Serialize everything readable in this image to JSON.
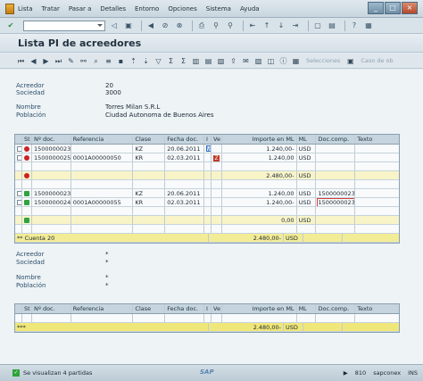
{
  "menu": {
    "items": [
      "Lista",
      "Tratar",
      "Pasar a",
      "Detalles",
      "Entorno",
      "Opciones",
      "Sistema",
      "Ayuda"
    ]
  },
  "page": {
    "title": "Lista PI de acreedores"
  },
  "toolbar2": {
    "selections_label": "Selecciones",
    "case_label": "Caso de ob"
  },
  "header1": {
    "acreedor_label": "Acreedor",
    "acreedor_value": "20",
    "sociedad_label": "Sociedad",
    "sociedad_value": "3000",
    "nombre_label": "Nombre",
    "nombre_value": "Torres Milan S.R.L",
    "poblacion_label": "Población",
    "poblacion_value": "Ciudad Autonoma de Buenos Aires"
  },
  "header2": {
    "acreedor_label": "Acreedor",
    "acreedor_value": "*",
    "sociedad_label": "Sociedad",
    "sociedad_value": "*",
    "nombre_label": "Nombre",
    "nombre_value": "*",
    "poblacion_label": "Población",
    "poblacion_value": "*"
  },
  "columns": {
    "st": "St",
    "doc": "Nº doc.",
    "ref": "Referencia",
    "clase": "Clase",
    "fecha": "Fecha doc.",
    "i": "I",
    "ve": "Ve",
    "importe": "Importe en ML",
    "ml": "ML",
    "comp": "Doc.comp.",
    "texto": "Texto"
  },
  "rows": [
    {
      "doc": "1500000023",
      "ref": "",
      "clase": "KZ",
      "fecha": "20.06.2011",
      "importe": "1.240,00-",
      "ml": "USD",
      "comp": ""
    },
    {
      "doc": "1500000025",
      "ref": "0001A00000050",
      "clase": "KR",
      "fecha": "02.03.2011",
      "importe": "1.240,00",
      "ml": "USD",
      "comp": ""
    },
    {
      "importe": "2.480,00-",
      "ml": "USD"
    },
    {
      "doc": "1500000023",
      "ref": "",
      "clase": "KZ",
      "fecha": "20.06.2011",
      "importe": "1.240,00",
      "ml": "USD",
      "comp": "1500000023"
    },
    {
      "doc": "1500000024",
      "ref": "0001A00000055",
      "clase": "KR",
      "fecha": "02.03.2011",
      "importe": "1.240,00-",
      "ml": "USD",
      "comp": "1500000023"
    },
    {
      "importe": "0,00",
      "ml": "USD"
    },
    {
      "label": "** Cuenta 20",
      "importe": "2.480,00-",
      "ml": "USD"
    }
  ],
  "table2": {
    "total_label": "***",
    "total_importe": "2.480,00-",
    "total_ml": "USD"
  },
  "marks": {
    "w": "W",
    "z": "Z"
  },
  "status": {
    "message": "Se visualizan 4 partidas",
    "sap": "SAP",
    "client": "810",
    "server": "sapconex",
    "mode": "INS"
  }
}
